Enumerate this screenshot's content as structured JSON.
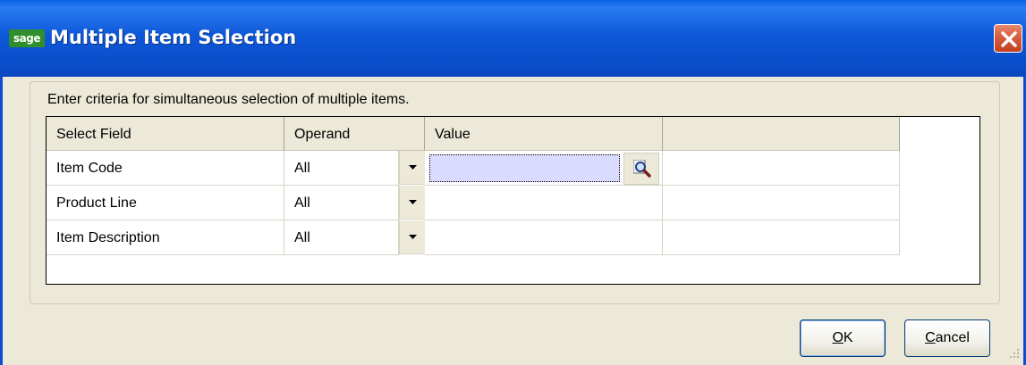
{
  "window": {
    "logo_text": "sage",
    "title": "Multiple Item Selection",
    "close_icon": "close-icon"
  },
  "dialog": {
    "instruction": "Enter criteria for simultaneous selection of multiple items."
  },
  "grid": {
    "columns": [
      "Select Field",
      "Operand",
      "Value",
      ""
    ],
    "rows": [
      {
        "field": "Item Code",
        "operand": "All",
        "value": ""
      },
      {
        "field": "Product Line",
        "operand": "All",
        "value": ""
      },
      {
        "field": "Item Description",
        "operand": "All",
        "value": ""
      }
    ],
    "active_value_bg": "#d9dbff",
    "lookup_icon": "magnifier-lookup-icon"
  },
  "buttons": {
    "ok": {
      "mnemonic": "O",
      "rest": "K"
    },
    "cancel": {
      "mnemonic": "C",
      "rest": "ancel"
    }
  },
  "colors": {
    "titlebar": "#0a4fcc",
    "dialog_bg": "#ece9d8",
    "close_button": "#d65a3a",
    "logo_bg": "#2f8f2a"
  }
}
